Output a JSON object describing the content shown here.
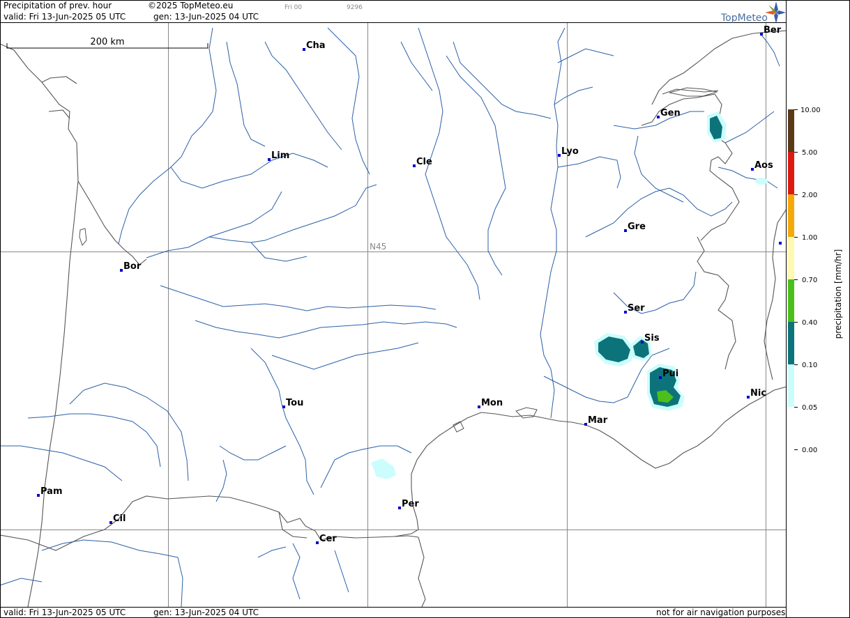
{
  "header": {
    "title": "Precipitation of prev. hour",
    "copyright": "©2025 TopMeteo.eu",
    "run_code": "Fri 00",
    "id_code": "9296",
    "valid_top": "valid:  Fri  13-Jun-2025  05 UTC",
    "gen_top": "gen: 13-Jun-2025 04 UTC"
  },
  "footer": {
    "valid": "valid:  Fri  13-Jun-2025  05 UTC",
    "gen": "gen: 13-Jun-2025 04 UTC",
    "disclaimer": "not for air navigation purposes"
  },
  "logo": {
    "text": "TopMeteo"
  },
  "scale_bar": {
    "label": "200 km"
  },
  "grid": {
    "lat_label": "N45"
  },
  "cities": [
    {
      "name": "Cha"
    },
    {
      "name": "Ber"
    },
    {
      "name": "Gen"
    },
    {
      "name": "Lim"
    },
    {
      "name": "Cle"
    },
    {
      "name": "Lyo"
    },
    {
      "name": "Aos"
    },
    {
      "name": "Gre"
    },
    {
      "name": "Bor"
    },
    {
      "name": "Ser"
    },
    {
      "name": "Sis"
    },
    {
      "name": "Pui"
    },
    {
      "name": "Tou"
    },
    {
      "name": "Mon"
    },
    {
      "name": "Nic"
    },
    {
      "name": "Mar"
    },
    {
      "name": "Per"
    },
    {
      "name": "Pam"
    },
    {
      "name": "Cil"
    },
    {
      "name": "Cer"
    }
  ],
  "legend": {
    "axis_label": "precipitation  [mm/hr]",
    "ticks": [
      "10.00",
      "5.00",
      "2.00",
      "1.00",
      "0.70",
      "0.40",
      "0.10",
      "0.05",
      "0.00"
    ],
    "colors": [
      "#5a3a16",
      "#dd1a10",
      "#f5a80a",
      "#fff8b0",
      "#4cbf1a",
      "#0d737a",
      "#ccfdfd"
    ]
  },
  "colors": {
    "coast": "#555555",
    "river": "#2a5fa8",
    "city_marker": "#0000cc",
    "grid": "#888888",
    "precip_light": "#ccfdfd",
    "precip_medium": "#0d737a",
    "precip_heavy": "#4cbf1a"
  }
}
